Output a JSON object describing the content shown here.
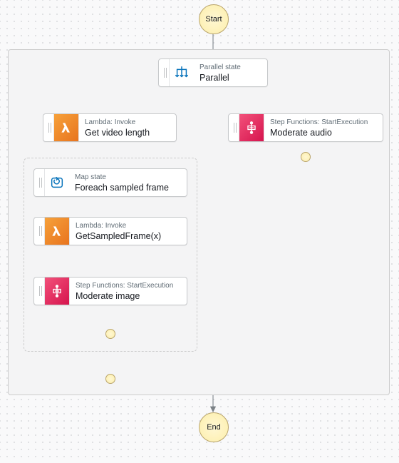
{
  "terminals": {
    "start": "Start",
    "end": "End"
  },
  "nodes": {
    "parallel": {
      "type": "Parallel state",
      "label": "Parallel"
    },
    "getLength": {
      "type": "Lambda: Invoke",
      "label": "Get video length"
    },
    "moderateAudio": {
      "type": "Step Functions: StartExecution",
      "label": "Moderate audio"
    },
    "map": {
      "type": "Map state",
      "label": "Foreach sampled frame"
    },
    "getFrame": {
      "type": "Lambda: Invoke",
      "label": "GetSampledFrame(x)"
    },
    "moderateImage": {
      "type": "Step Functions: StartExecution",
      "label": "Moderate image"
    }
  },
  "icons": {
    "parallel": "parallel-icon",
    "lambda": "lambda-icon",
    "sfn": "step-functions-icon",
    "map": "map-icon"
  }
}
